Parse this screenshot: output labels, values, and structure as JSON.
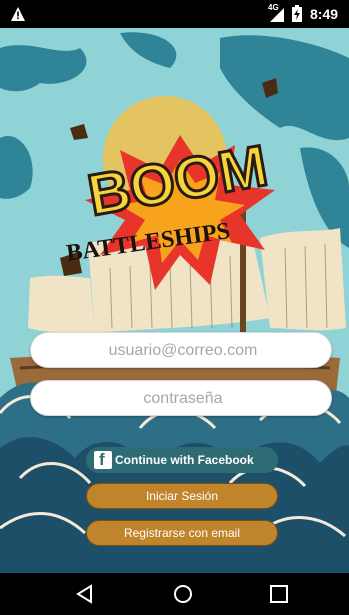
{
  "status_bar": {
    "network_type": "4G",
    "time": "8:49"
  },
  "logo": {
    "title": "BOOM",
    "subtitle": "BATTLESHIPS"
  },
  "form": {
    "email_placeholder": "usuario@correo.com",
    "password_placeholder": "contraseña"
  },
  "buttons": {
    "facebook_label": "Continue with Facebook",
    "login_label": "Iniciar Sesión",
    "register_label": "Registrarse con email"
  },
  "colors": {
    "sky": "#8fd3d6",
    "facebook_button": "#2f6b74",
    "primary_button": "#c0842b",
    "map_land": "#2f8597"
  },
  "icons": {
    "status": [
      "warning-icon",
      "signal-icon",
      "battery-icon"
    ],
    "nav": [
      "back-icon",
      "home-icon",
      "recent-apps-icon"
    ],
    "facebook": "facebook-icon"
  }
}
